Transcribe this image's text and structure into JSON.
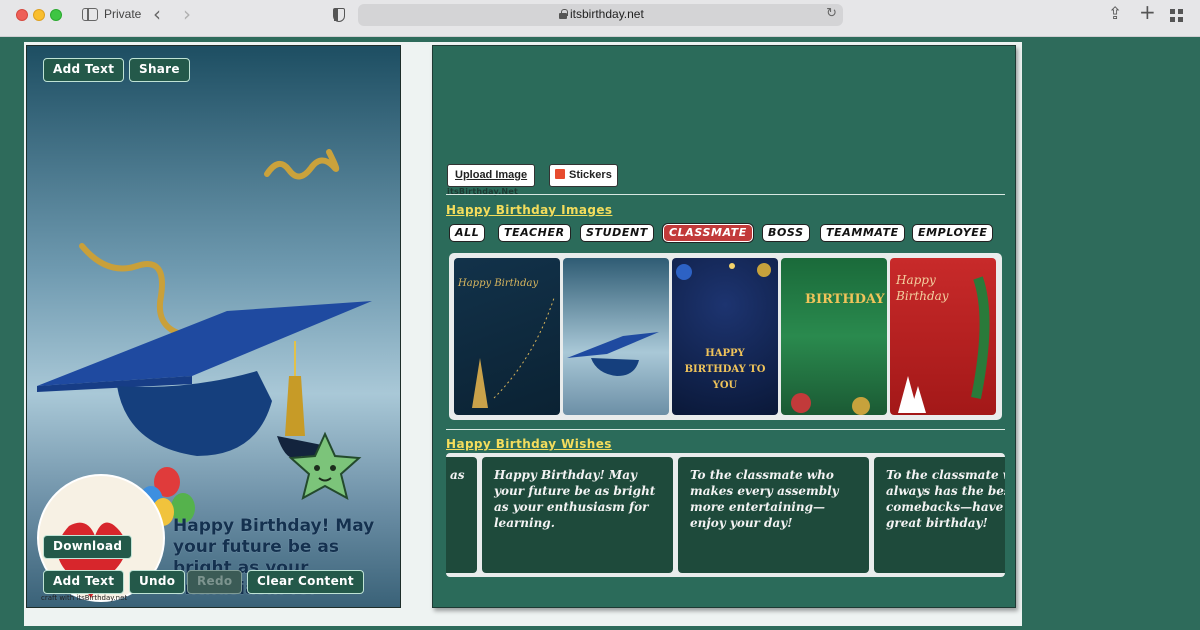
{
  "browser": {
    "mode_label": "Private",
    "url": "itsbirthday.net"
  },
  "card": {
    "top_buttons": {
      "add_text": "Add Text",
      "share": "Share"
    },
    "message": "Happy Birthday! May your future be as bright as your enthusiasm for",
    "download": "Download",
    "bottom_buttons": {
      "add_text": "Add Text",
      "undo": "Undo",
      "redo": "Redo",
      "clear": "Clear Content"
    },
    "watermark": "craft with itsBirthday.net"
  },
  "panel": {
    "upload_label": "Upload Image",
    "stickers_label": "Stickers",
    "small_logo": "itsBirthday.Net",
    "images_title": "Happy Birthday Images",
    "categories": [
      "ALL",
      "TEACHER",
      "STUDENT",
      "CLASSMATE",
      "BOSS",
      "TEAMMATE",
      "EMPLOYEE"
    ],
    "active_category": "CLASSMATE",
    "thumbnails": [
      {
        "label": "Happy Birthday",
        "style": "dark-gold"
      },
      {
        "label": "",
        "style": "graduation-cap"
      },
      {
        "label": "HAPPY BIRTHDAY TO YOU",
        "style": "navy-lights"
      },
      {
        "label": "BIRTHDAY",
        "style": "green-gold"
      },
      {
        "label": "Happy Birthday",
        "style": "red-christmas"
      }
    ],
    "wishes_title": "Happy Birthday Wishes",
    "wishes": [
      "Happy Birthday! May your future be as bright as your enthusiasm for learning.",
      "To the classmate who makes every assembly more entertaining—enjoy your day!",
      "To the classmate who always has the best comebacks—have a great birthday!"
    ],
    "wish_partial_left": "as"
  },
  "colors": {
    "page_bg": "#2e6b5b",
    "panel_bg": "#2b6b5a",
    "title_yellow": "#f4dd5c",
    "active_category": "#c23a3a",
    "wish_card": "#1e4a3b"
  }
}
